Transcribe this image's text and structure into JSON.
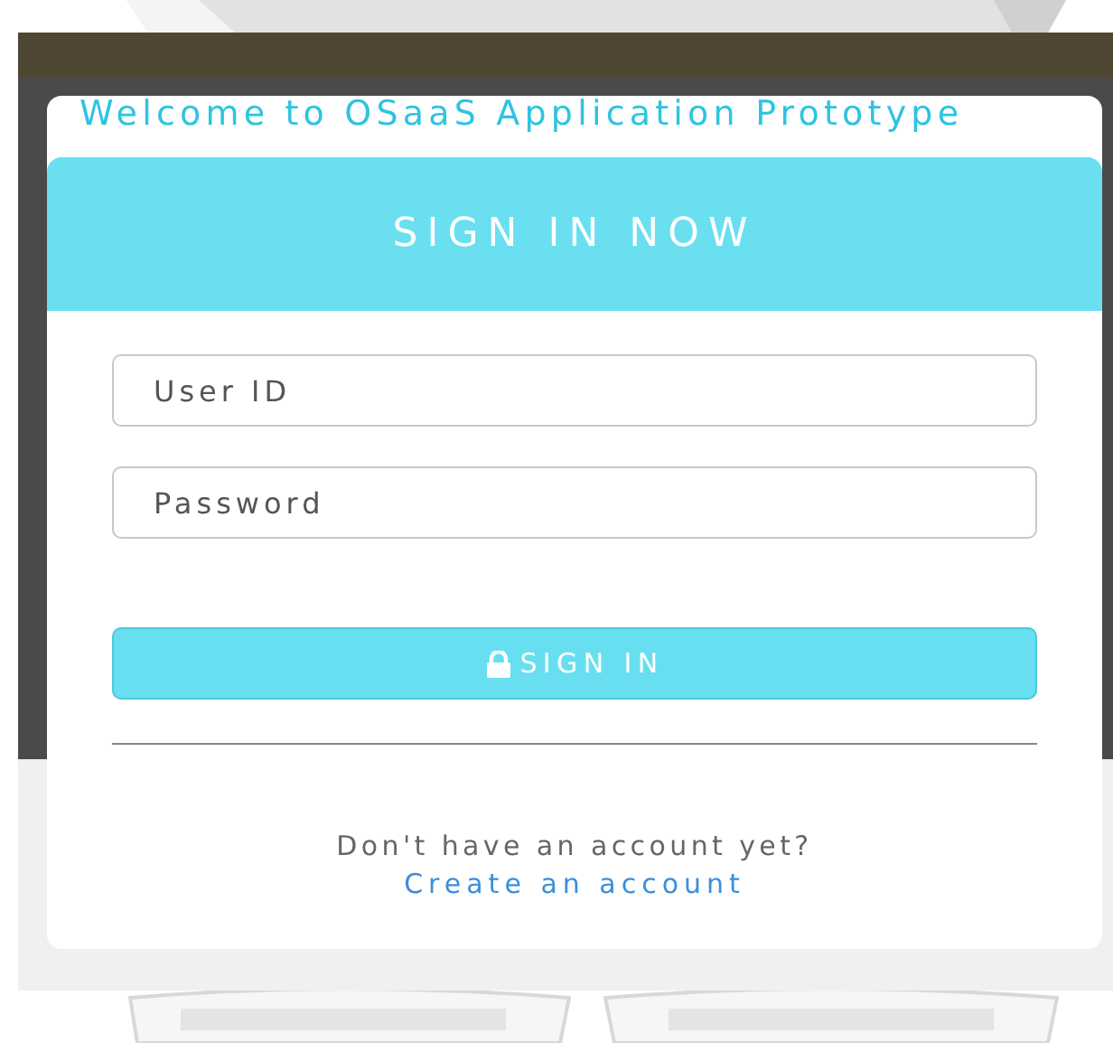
{
  "welcome": "Welcome to OSaaS Application Prototype",
  "header": "SIGN IN NOW",
  "fields": [
    {
      "placeholder": "User ID"
    },
    {
      "placeholder": "Password"
    }
  ],
  "sign_in_button": "SIGN IN",
  "signup_prompt": "Don't have an account yet?",
  "signup_link": "Create an account"
}
